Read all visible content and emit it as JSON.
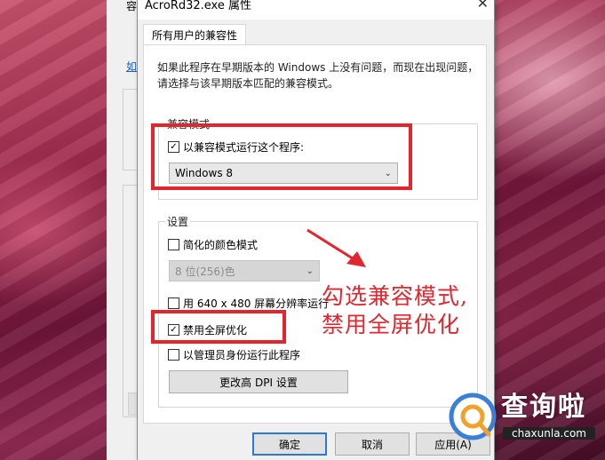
{
  "background_window": {
    "title_fragment": "容",
    "link_fragment": "如"
  },
  "dialog": {
    "title": "AcroRd32.exe 属性",
    "close_glyph": "✕",
    "tab_label": "所有用户的兼容性",
    "description_line1": "如果此程序在早期版本的 Windows 上没有问题，而现在出现问题，",
    "description_line2": "请选择与该早期版本匹配的兼容模式。",
    "compat_mode": {
      "legend": "兼容模式",
      "checkbox_label": "以兼容模式运行这个程序:",
      "checked": true,
      "selected_os": "Windows 8"
    },
    "settings": {
      "legend": "设置",
      "reduced_color": {
        "label": "简化的颜色模式",
        "checked": false
      },
      "color_select": "8 位(256)色",
      "resolution": {
        "label": "用 640 x 480 屏幕分辨率运行",
        "checked": false
      },
      "disable_fullscreen": {
        "label": "禁用全屏优化",
        "checked": true
      },
      "run_as_admin": {
        "label": "以管理员身份运行此程序",
        "checked": false
      },
      "dpi_button": "更改高 DPI 设置"
    },
    "buttons": {
      "ok": "确定",
      "cancel": "取消",
      "apply": "应用(A)"
    }
  },
  "annotation": {
    "line1": "勾选兼容模式,",
    "line2": "禁用全屏优化",
    "color": "#e3262e"
  },
  "watermark": {
    "name": "查询啦",
    "url": "chaxunla.com"
  },
  "icons": {
    "check": "✓",
    "chevron": "⌄"
  }
}
